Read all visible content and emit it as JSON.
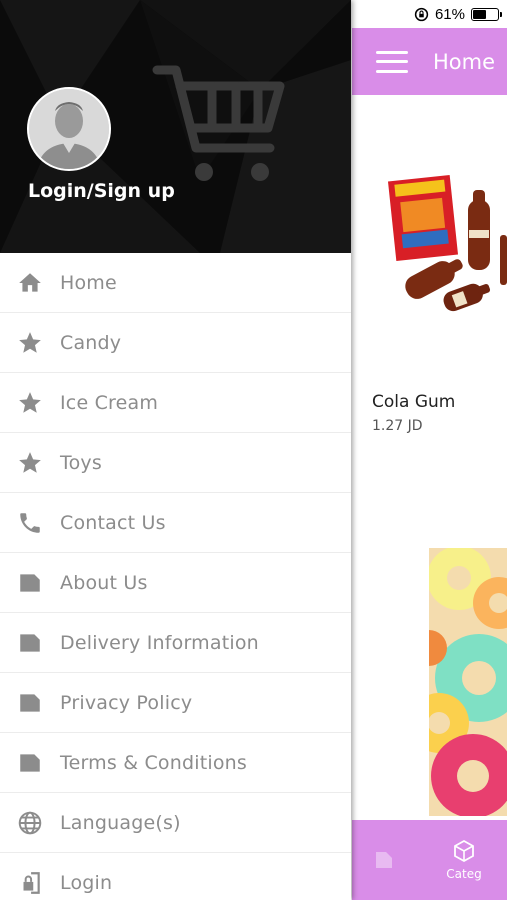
{
  "status_bar": {
    "battery_percent": "61%",
    "battery_level": 0.61,
    "icons": [
      "orientation-lock-icon",
      "battery-icon"
    ]
  },
  "app_bar": {
    "title": "Home",
    "menu_icon": "hamburger-icon"
  },
  "products": [
    {
      "name": "Cola Gum",
      "price": "1.27 JD"
    }
  ],
  "drawer": {
    "login_label": "Login/Sign up",
    "items": [
      {
        "label": "Home",
        "icon": "home-icon"
      },
      {
        "label": "Candy",
        "icon": "star-icon"
      },
      {
        "label": "Ice Cream",
        "icon": "star-icon"
      },
      {
        "label": "Toys",
        "icon": "star-icon"
      },
      {
        "label": "Contact Us",
        "icon": "phone-icon"
      },
      {
        "label": "About Us",
        "icon": "page-icon"
      },
      {
        "label": "Delivery Information",
        "icon": "page-icon"
      },
      {
        "label": "Privacy Policy",
        "icon": "page-icon"
      },
      {
        "label": "Terms & Conditions",
        "icon": "page-icon"
      },
      {
        "label": "Language(s)",
        "icon": "globe-icon"
      },
      {
        "label": "Login",
        "icon": "login-icon"
      }
    ]
  },
  "bottom_nav": {
    "tab2_label": "Categ"
  },
  "colors": {
    "accent": "#d98de8",
    "drawer_header": "#0b0b0b",
    "menu_text": "#8c8c8c",
    "menu_icon": "#8c8c8c"
  }
}
